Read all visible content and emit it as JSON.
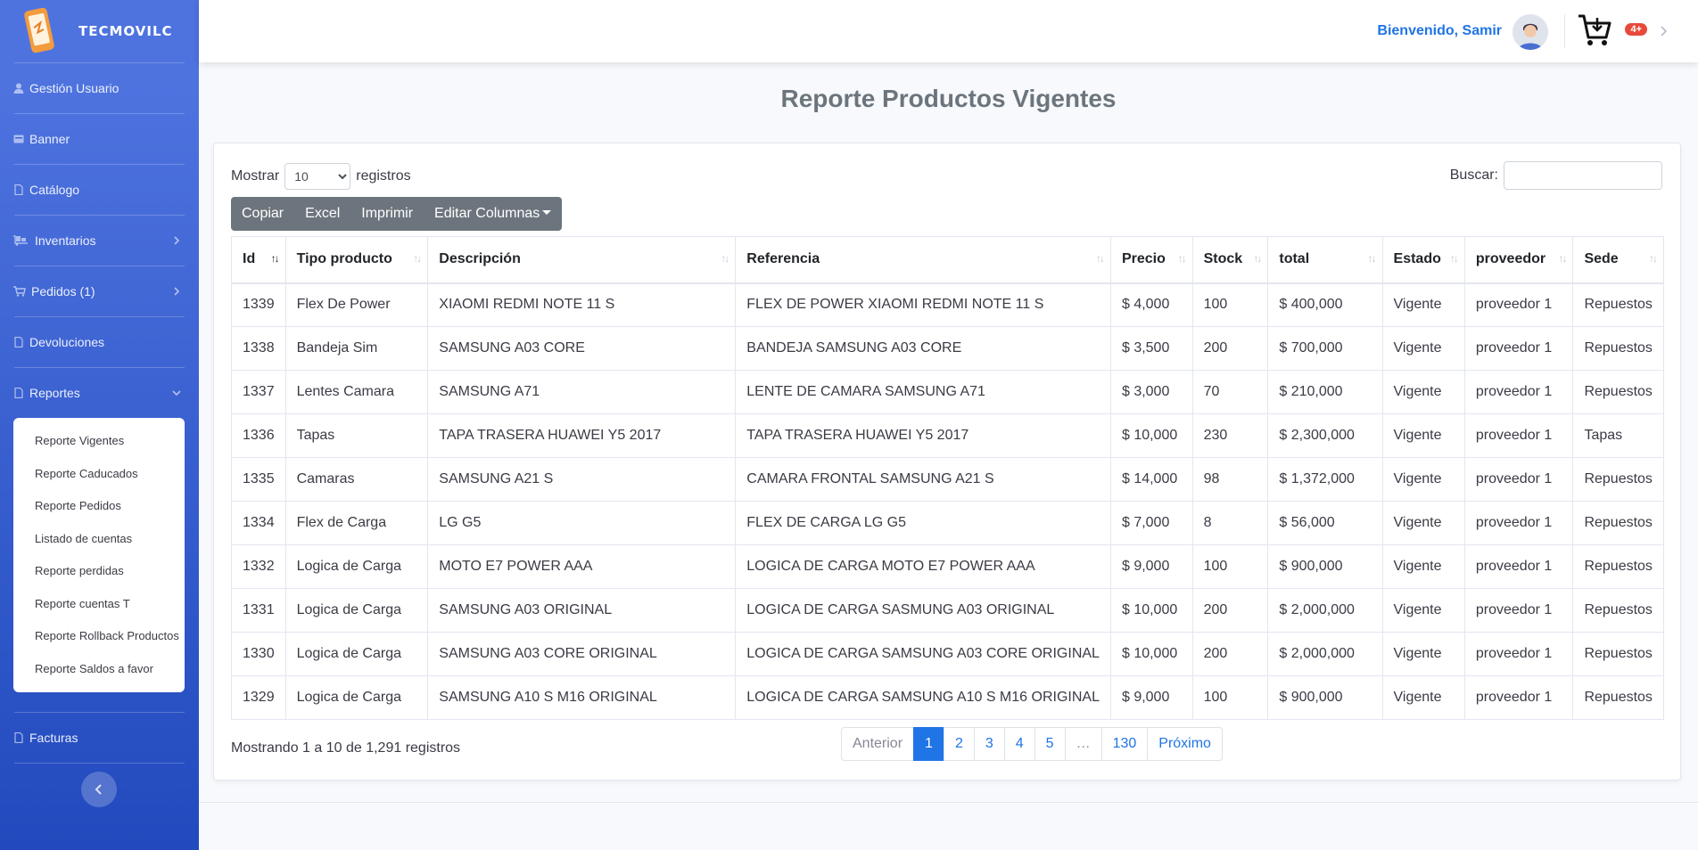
{
  "brand": {
    "name": "TECMOVILC"
  },
  "sidebar": {
    "items": [
      {
        "label": "Gestión Usuario",
        "icon": "user-icon"
      },
      {
        "label": "Banner",
        "icon": "banner-icon"
      },
      {
        "label": "Catálogo",
        "icon": "file-icon"
      },
      {
        "label": "Inventarios",
        "icon": "dolly-icon"
      },
      {
        "label": "Pedidos (1)",
        "icon": "cart-icon"
      },
      {
        "label": "Devoluciones",
        "icon": "file-icon"
      },
      {
        "label": "Reportes",
        "icon": "file-icon"
      }
    ],
    "submenu": [
      "Reporte Vigentes",
      "Reporte Caducados",
      "Reporte Pedidos",
      "Listado de cuentas",
      "Reporte perdidas",
      "Reporte cuentas T",
      "Reporte Rollback Productos",
      "Reporte Saldos a favor"
    ],
    "after": {
      "label": "Facturas",
      "icon": "file-icon"
    }
  },
  "topbar": {
    "welcome": "Bienvenido, Samir",
    "cart_badge": "4+"
  },
  "page": {
    "title": "Reporte Productos Vigentes"
  },
  "controls": {
    "show_label": "Mostrar",
    "show_value": "10",
    "records_label": "registros",
    "search_label": "Buscar:",
    "search_value": "",
    "buttons": [
      "Copiar",
      "Excel",
      "Imprimir",
      "Editar Columnas"
    ]
  },
  "table": {
    "headers": [
      "Id",
      "Tipo producto",
      "Descripción",
      "Referencia",
      "Precio",
      "Stock",
      "total",
      "Estado",
      "proveedor",
      "Sede"
    ],
    "rows": [
      [
        "1339",
        "Flex De Power",
        "XIAOMI REDMI NOTE 11 S",
        "FLEX DE POWER XIAOMI REDMI NOTE 11 S",
        "$ 4,000",
        "100",
        "$ 400,000",
        "Vigente",
        "proveedor 1",
        "Repuestos"
      ],
      [
        "1338",
        "Bandeja Sim",
        "SAMSUNG A03 CORE",
        "BANDEJA SAMSUNG A03 CORE",
        "$ 3,500",
        "200",
        "$ 700,000",
        "Vigente",
        "proveedor 1",
        "Repuestos"
      ],
      [
        "1337",
        "Lentes Camara",
        "SAMSUNG A71",
        "LENTE DE CAMARA SAMSUNG A71",
        "$ 3,000",
        "70",
        "$ 210,000",
        "Vigente",
        "proveedor 1",
        "Repuestos"
      ],
      [
        "1336",
        "Tapas",
        "TAPA TRASERA HUAWEI Y5 2017",
        "TAPA TRASERA HUAWEI Y5 2017",
        "$ 10,000",
        "230",
        "$ 2,300,000",
        "Vigente",
        "proveedor 1",
        "Tapas"
      ],
      [
        "1335",
        "Camaras",
        "SAMSUNG A21 S",
        "CAMARA FRONTAL SAMSUNG A21 S",
        "$ 14,000",
        "98",
        "$ 1,372,000",
        "Vigente",
        "proveedor 1",
        "Repuestos"
      ],
      [
        "1334",
        "Flex de Carga",
        "LG G5",
        "FLEX DE CARGA LG G5",
        "$ 7,000",
        "8",
        "$ 56,000",
        "Vigente",
        "proveedor 1",
        "Repuestos"
      ],
      [
        "1332",
        "Logica de Carga",
        "MOTO E7 POWER AAA",
        "LOGICA DE CARGA MOTO E7 POWER AAA",
        "$ 9,000",
        "100",
        "$ 900,000",
        "Vigente",
        "proveedor 1",
        "Repuestos"
      ],
      [
        "1331",
        "Logica de Carga",
        "SAMSUNG A03 ORIGINAL",
        "LOGICA DE CARGA SASMUNG A03 ORIGINAL",
        "$ 10,000",
        "200",
        "$ 2,000,000",
        "Vigente",
        "proveedor 1",
        "Repuestos"
      ],
      [
        "1330",
        "Logica de Carga",
        "SAMSUNG A03 CORE ORIGINAL",
        "LOGICA DE CARGA SAMSUNG A03 CORE ORIGINAL",
        "$ 10,000",
        "200",
        "$ 2,000,000",
        "Vigente",
        "proveedor 1",
        "Repuestos"
      ],
      [
        "1329",
        "Logica de Carga",
        "SAMSUNG A10 S M16 ORIGINAL",
        "LOGICA DE CARGA SAMSUNG A10 S M16 ORIGINAL",
        "$ 9,000",
        "100",
        "$ 900,000",
        "Vigente",
        "proveedor 1",
        "Repuestos"
      ]
    ]
  },
  "footer": {
    "info": "Mostrando 1 a 10 de 1,291 registros",
    "pagination": [
      "Anterior",
      "1",
      "2",
      "3",
      "4",
      "5",
      "…",
      "130",
      "Próximo"
    ],
    "active_page": "1"
  },
  "colors": {
    "sidebar_top": "#4e73df",
    "sidebar_bottom": "#224abe",
    "accent": "#1f74e6",
    "badge": "#e74a3b"
  }
}
